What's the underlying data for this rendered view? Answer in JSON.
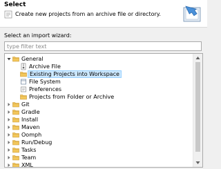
{
  "header": {
    "title": "Select",
    "description": "Create new projects from an archive file or directory."
  },
  "wizard_label": "Select an import wizard:",
  "filter": {
    "placeholder": "type filter text",
    "value": ""
  },
  "tree": {
    "general": {
      "label": "General",
      "children": {
        "archive_file": "Archive File",
        "existing_projects": "Existing Projects into Workspace",
        "file_system": "File System",
        "preferences": "Preferences",
        "projects_from_folder": "Projects from Folder or Archive"
      },
      "selected_child": "existing_projects"
    },
    "categories": [
      "Git",
      "Gradle",
      "Install",
      "Maven",
      "Oomph",
      "Run/Debug",
      "Tasks",
      "Team",
      "XML"
    ]
  },
  "colors": {
    "selection_bg": "#cce8ff",
    "selection_border": "#99d1ff",
    "folder": "#e8b64c"
  }
}
